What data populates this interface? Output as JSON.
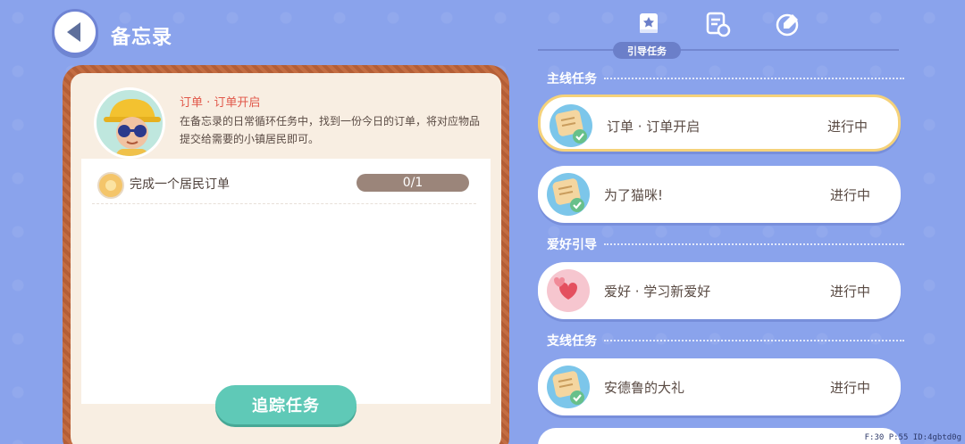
{
  "header": {
    "title": "备忘录"
  },
  "tabs": {
    "active_label": "引导任务"
  },
  "memo": {
    "quest_name": "订单 · 订单开启",
    "quest_desc": "在备忘录的日常循环任务中，找到一份今日的订单，将对应物品提交给需要的小镇居民即可。",
    "objective": "完成一个居民订单",
    "progress": "0/1",
    "track_button": "追踪任务"
  },
  "sections": [
    {
      "title": "主线任务"
    },
    {
      "title": "爱好引导"
    },
    {
      "title": "支线任务"
    }
  ],
  "quests": [
    {
      "title": "订单 · 订单开启",
      "status": "进行中",
      "icon": "order-note-icon"
    },
    {
      "title": "为了猫咪!",
      "status": "进行中",
      "icon": "order-note-icon"
    },
    {
      "title": "爱好 · 学习新爱好",
      "status": "进行中",
      "icon": "heart-icon"
    },
    {
      "title": "安德鲁的大礼",
      "status": "进行中",
      "icon": "order-note-icon"
    }
  ],
  "debug": "F:30  P:55  ID:4gbtd0g"
}
